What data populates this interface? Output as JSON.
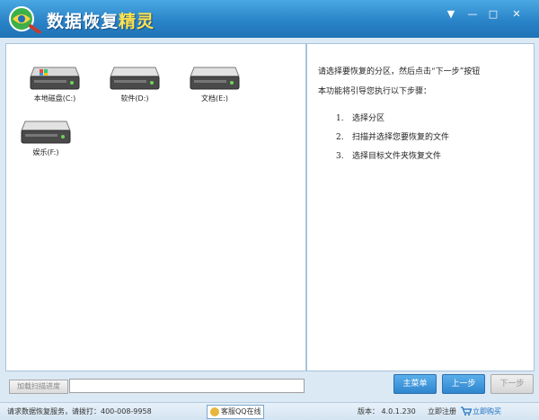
{
  "app": {
    "title_part1": "数据恢复",
    "title_part2": "精灵",
    "controls": {
      "menu": "▼",
      "minimize": "—",
      "maximize": "□",
      "close": "✕"
    }
  },
  "drives": [
    {
      "label": "本地磁盘(C:)",
      "icon": "system-drive-icon"
    },
    {
      "label": "软件(D:)",
      "icon": "hard-drive-icon"
    },
    {
      "label": "文档(E:)",
      "icon": "hard-drive-icon"
    },
    {
      "label": "娱乐(F:)",
      "icon": "hard-drive-icon"
    }
  ],
  "instructions": {
    "line1": "请选择要恢复的分区，然后点击“下一步”按钮",
    "line2": "本功能将引导您执行以下步骤：",
    "steps": [
      {
        "num": "1.",
        "text": "选择分区"
      },
      {
        "num": "2.",
        "text": "扫描并选择您要恢复的文件"
      },
      {
        "num": "3.",
        "text": "选择目标文件夹恢复文件"
      }
    ]
  },
  "scan": {
    "load_label": "加载扫描进度",
    "progress": 0.0
  },
  "buttons": {
    "main_menu": "主菜单",
    "prev": "上一步",
    "next": "下一步"
  },
  "status": {
    "service": "请求数据恢复服务，请拨打：400-008-9958",
    "qq": "客服QQ在线",
    "version": "版本： 4.0.1.230",
    "register": "立即注册",
    "buy": "立即购买"
  },
  "colors": {
    "accent": "#2f86cf",
    "title_accent": "#ffe34d"
  }
}
